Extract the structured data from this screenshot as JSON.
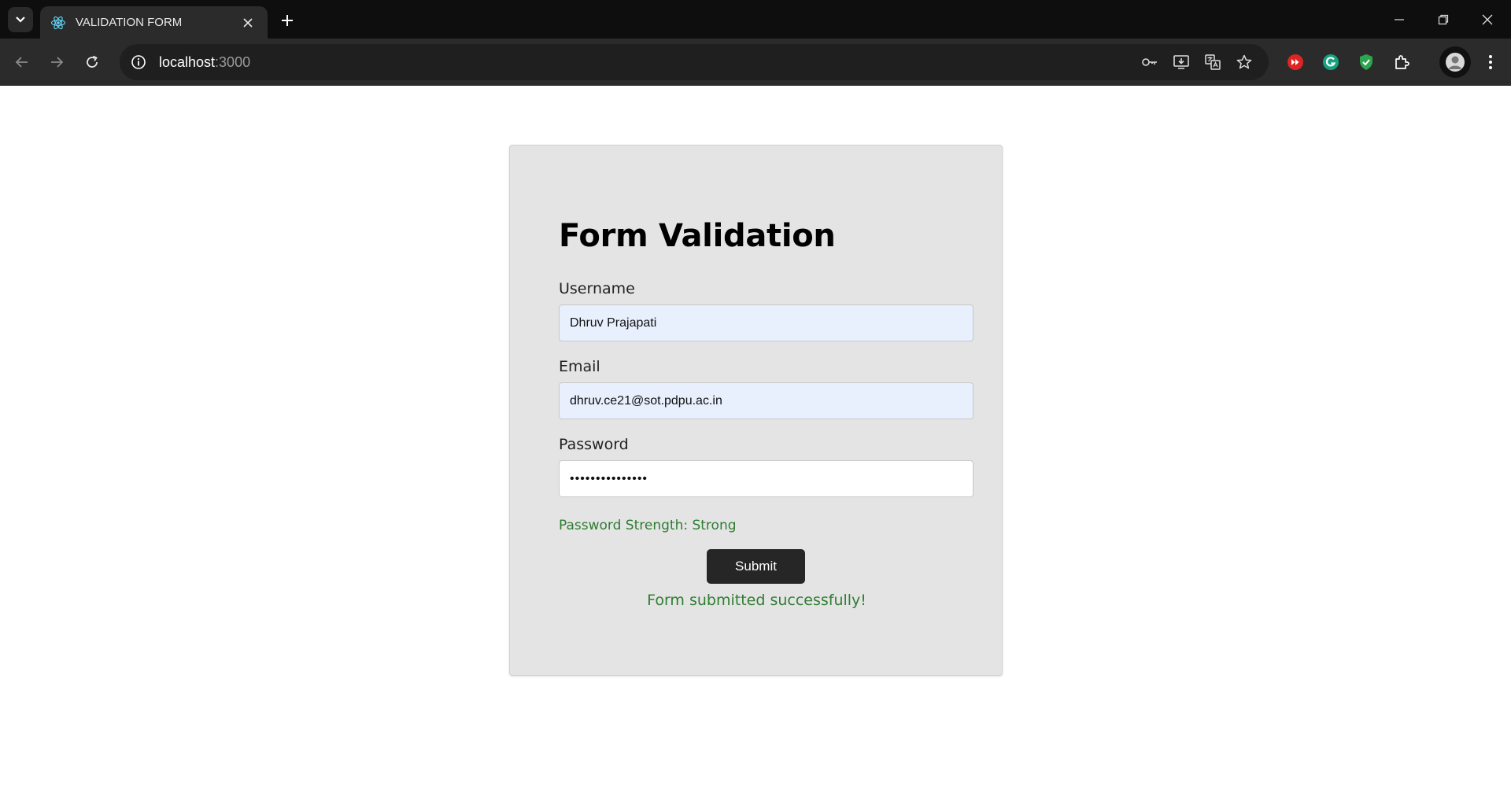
{
  "browser": {
    "tab_title": "VALIDATION FORM",
    "url_host": "localhost",
    "url_port": ":3000"
  },
  "form": {
    "heading": "Form Validation",
    "username_label": "Username",
    "username_value": "Dhruv Prajapati",
    "email_label": "Email",
    "email_value": "dhruv.ce21@sot.pdpu.ac.in",
    "password_label": "Password",
    "password_masked": "•••••••••••••••",
    "strength_text": "Password Strength: Strong",
    "submit_label": "Submit",
    "success_message": "Form submitted successfully!"
  },
  "colors": {
    "success_green": "#2e7d32",
    "card_bg": "#e4e4e4",
    "button_bg": "#262626",
    "autofill_bg": "#e8f0fe"
  }
}
